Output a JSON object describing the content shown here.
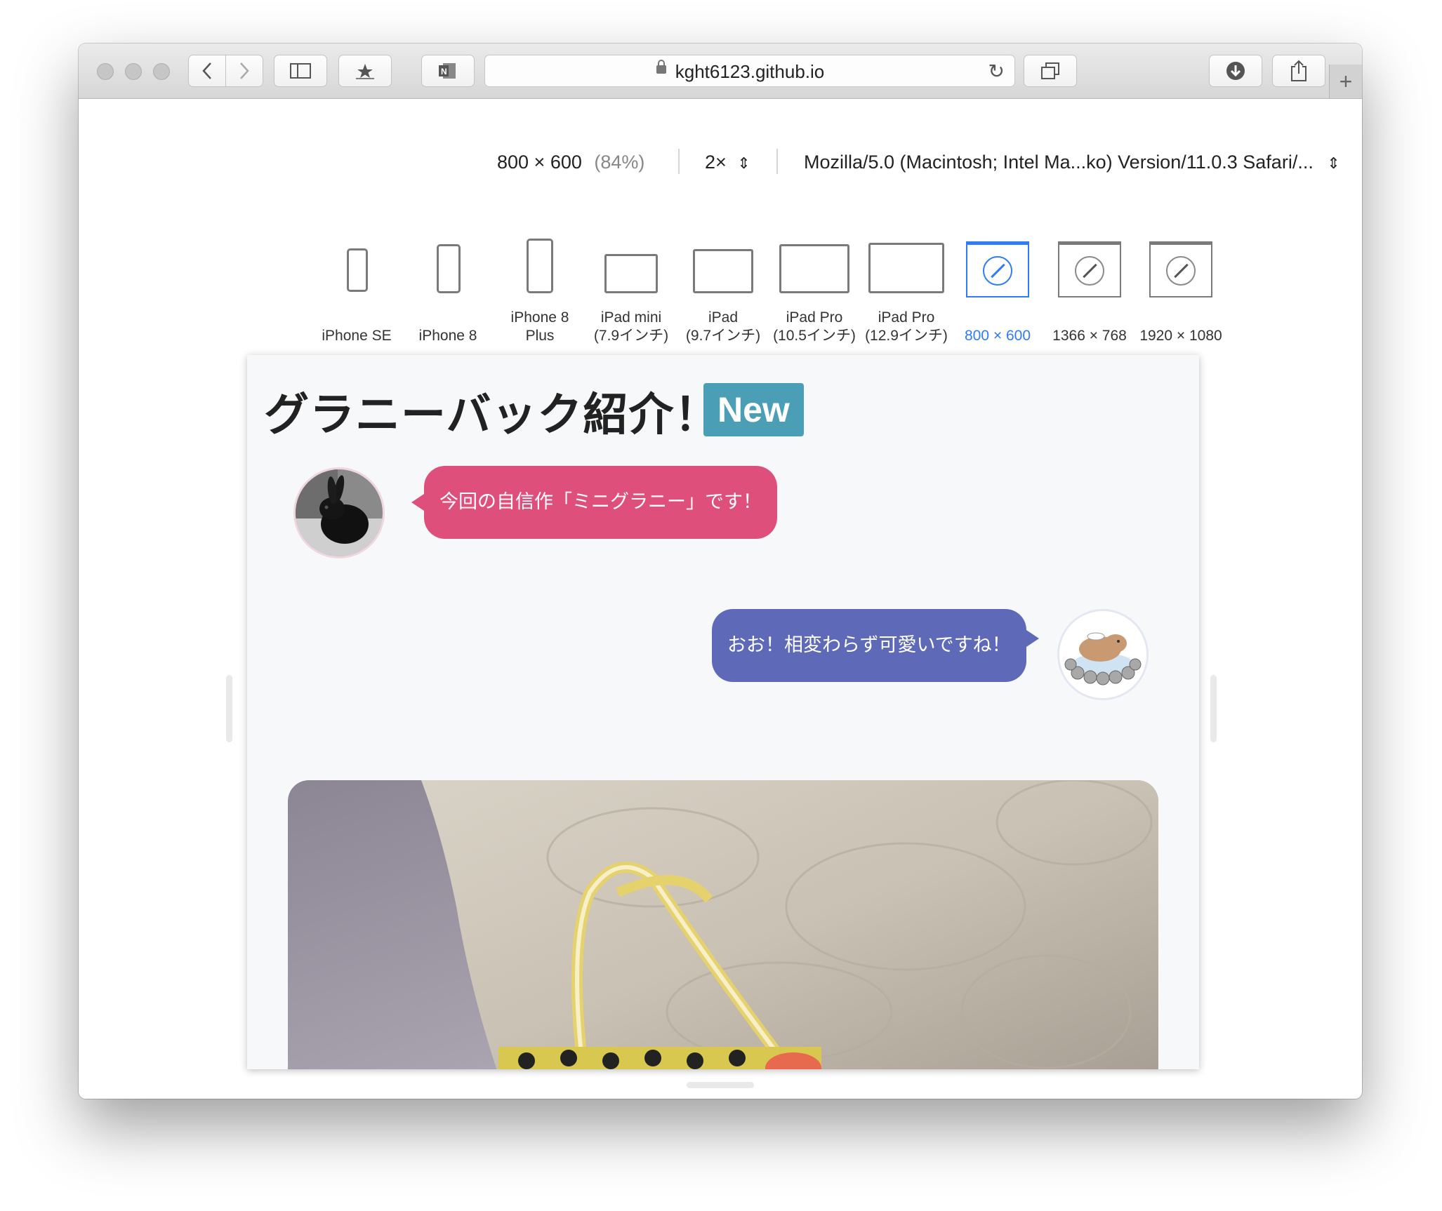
{
  "browser": {
    "address": "kght6123.github.io",
    "new_tab": "+"
  },
  "rdm": {
    "size": "800 × 600",
    "scale": "(84%)",
    "pixel_ratio": "2×",
    "user_agent": "Mozilla/5.0 (Macintosh; Intel Ma...ko) Version/11.0.3 Safari/...",
    "devices": [
      {
        "line1": "iPhone SE",
        "line2": ""
      },
      {
        "line1": "iPhone 8",
        "line2": ""
      },
      {
        "line1": "iPhone 8",
        "line2": "Plus"
      },
      {
        "line1": "iPad mini",
        "line2": "(7.9インチ)"
      },
      {
        "line1": "iPad",
        "line2": "(9.7インチ)"
      },
      {
        "line1": "iPad Pro",
        "line2": "(10.5インチ)"
      },
      {
        "line1": "iPad Pro",
        "line2": "(12.9インチ)"
      },
      {
        "line1": "800 × 600",
        "line2": ""
      },
      {
        "line1": "1366 × 768",
        "line2": ""
      },
      {
        "line1": "1920 × 1080",
        "line2": ""
      }
    ],
    "active_device": "800 × 600"
  },
  "page": {
    "title": "グラニーバック紹介！",
    "badge": "New",
    "messages": [
      {
        "side": "left",
        "text": "今回の自信作「ミニグラニー」です！"
      },
      {
        "side": "right",
        "text": "おお！相変わらず可愛いですね！"
      }
    ]
  },
  "colors": {
    "bubble_left": "#de4f7b",
    "bubble_right": "#5e6ab8",
    "badge": "#4a9fb7",
    "active_device": "#2f7cf6"
  }
}
